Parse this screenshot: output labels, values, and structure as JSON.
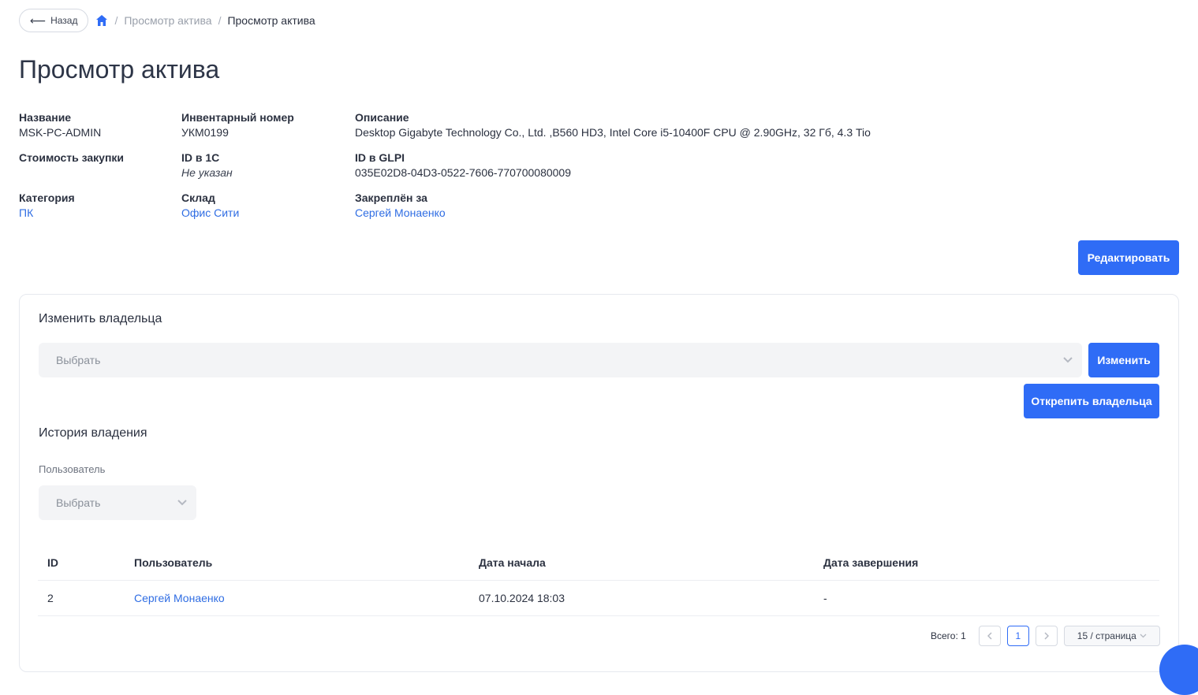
{
  "breadcrumb": {
    "back_label": "Назад",
    "items": [
      "Просмотр актива",
      "Просмотр актива"
    ],
    "separator": "/"
  },
  "page_title": "Просмотр актива",
  "fields": {
    "name": {
      "label": "Название",
      "value": "MSK-PC-ADMIN"
    },
    "inventory": {
      "label": "Инвентарный номер",
      "value": "УКМ0199"
    },
    "description": {
      "label": "Описание",
      "value": "Desktop Gigabyte Technology Co., Ltd. ,B560 HD3, Intel Core i5-10400F CPU @ 2.90GHz, 32 Гб, 4.3 Tio"
    },
    "cost": {
      "label": "Стоимость закупки",
      "value": ""
    },
    "id1c": {
      "label": "ID в 1С",
      "value": "Не указан"
    },
    "glpi": {
      "label": "ID в GLPI",
      "value": "035E02D8-04D3-0522-7606-770700080009"
    },
    "category": {
      "label": "Категория",
      "value": "ПК"
    },
    "warehouse": {
      "label": "Склад",
      "value": "Офис Сити"
    },
    "assigned": {
      "label": "Закреплён за",
      "value": "Сергей Монаенко"
    }
  },
  "edit_button": "Редактировать",
  "owner_section": {
    "title": "Изменить владельца",
    "select_placeholder": "Выбрать",
    "change_button": "Изменить",
    "unassign_button": "Открепить владельца"
  },
  "history_section": {
    "title": "История владения",
    "filter_label": "Пользователь",
    "filter_placeholder": "Выбрать",
    "columns": [
      "ID",
      "Пользователь",
      "Дата начала",
      "Дата завершения"
    ],
    "rows": [
      {
        "id": "2",
        "user": "Сергей Монаенко",
        "start": "07.10.2024 18:03",
        "end": "-"
      }
    ]
  },
  "pagination": {
    "total_label": "Всего: 1",
    "current_page": "1",
    "page_size": "15 / страница"
  },
  "colors": {
    "accent": "#2f6cf6",
    "link": "#2f6de3"
  }
}
